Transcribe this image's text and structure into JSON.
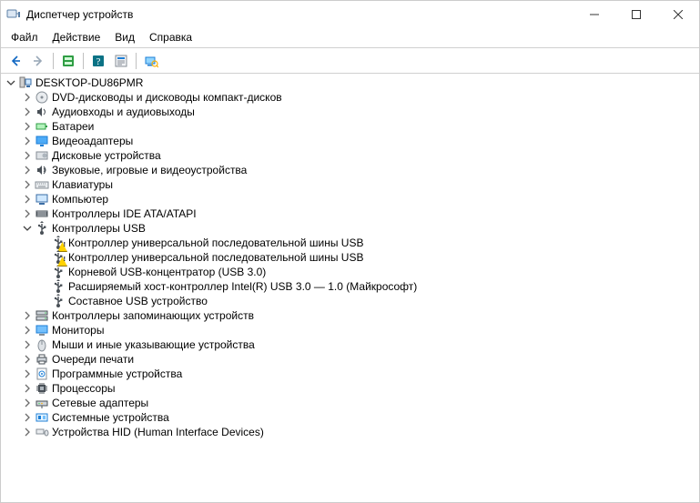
{
  "window": {
    "title": "Диспетчер устройств"
  },
  "menu": {
    "file": "Файл",
    "action": "Действие",
    "view": "Вид",
    "help": "Справка"
  },
  "toolbar": {
    "back": "Назад",
    "forward": "Вперёд",
    "show_hidden": "Показать скрытые",
    "help": "Справка",
    "properties": "Свойства",
    "scan": "Обновить конфигурацию"
  },
  "root": {
    "label": "DESKTOP-DU86PMR"
  },
  "categories": [
    {
      "label": "DVD-дисководы и дисководы компакт-дисков",
      "icon": "disc"
    },
    {
      "label": "Аудиовходы и аудиовыходы",
      "icon": "audio"
    },
    {
      "label": "Батареи",
      "icon": "battery"
    },
    {
      "label": "Видеоадаптеры",
      "icon": "display"
    },
    {
      "label": "Дисковые устройства",
      "icon": "drive"
    },
    {
      "label": "Звуковые, игровые и видеоустройства",
      "icon": "sound"
    },
    {
      "label": "Клавиатуры",
      "icon": "keyboard"
    },
    {
      "label": "Компьютер",
      "icon": "computer"
    },
    {
      "label": "Контроллеры IDE ATA/ATAPI",
      "icon": "ide"
    },
    {
      "label": "Контроллеры USB",
      "icon": "usb",
      "expanded": true,
      "children": [
        {
          "label": "Контроллер универсальной последовательной шины USB",
          "icon": "usb",
          "warn": true
        },
        {
          "label": "Контроллер универсальной последовательной шины USB",
          "icon": "usb",
          "warn": true
        },
        {
          "label": "Корневой USB-концентратор (USB 3.0)",
          "icon": "usb"
        },
        {
          "label": "Расширяемый хост-контроллер Intel(R) USB 3.0 — 1.0 (Майкрософт)",
          "icon": "usb"
        },
        {
          "label": "Составное USB устройство",
          "icon": "usb"
        }
      ]
    },
    {
      "label": "Контроллеры запоминающих устройств",
      "icon": "storage"
    },
    {
      "label": "Мониторы",
      "icon": "monitor"
    },
    {
      "label": "Мыши и иные указывающие устройства",
      "icon": "mouse"
    },
    {
      "label": "Очереди печати",
      "icon": "printer"
    },
    {
      "label": "Программные устройства",
      "icon": "software"
    },
    {
      "label": "Процессоры",
      "icon": "cpu"
    },
    {
      "label": "Сетевые адаптеры",
      "icon": "network"
    },
    {
      "label": "Системные устройства",
      "icon": "system"
    },
    {
      "label": "Устройства HID (Human Interface Devices)",
      "icon": "hid"
    }
  ]
}
